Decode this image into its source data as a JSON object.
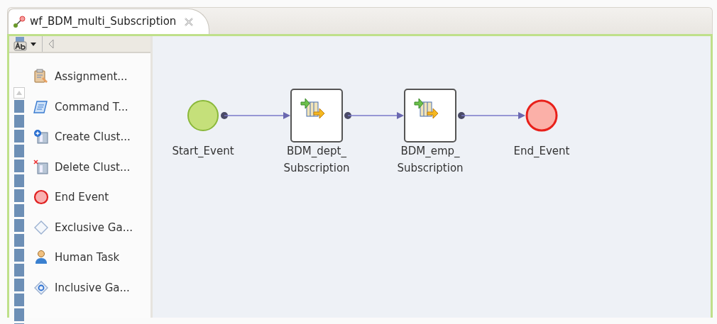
{
  "editor_tab": {
    "title": "wf_BDM_multi_Subscription",
    "selected": true
  },
  "palette": {
    "items": [
      {
        "label": "Assignment...",
        "kind": "assignment"
      },
      {
        "label": "Command  T...",
        "kind": "command"
      },
      {
        "label": "Create  Clust...",
        "kind": "create-cluster"
      },
      {
        "label": "Delete  Clust...",
        "kind": "delete-cluster"
      },
      {
        "label": "End Event",
        "kind": "end"
      },
      {
        "label": "Exclusive Ga...",
        "kind": "exclusive"
      },
      {
        "label": "Human Task",
        "kind": "human"
      },
      {
        "label": "Inclusive Ga...",
        "kind": "inclusive"
      }
    ]
  },
  "canvas": {
    "nodes": [
      {
        "kind": "start",
        "label_lines": [
          "Start_Event"
        ]
      },
      {
        "kind": "task",
        "label_lines": [
          "BDM_dept_",
          "Subscription"
        ]
      },
      {
        "kind": "task",
        "label_lines": [
          "BDM_emp_",
          "Subscription"
        ]
      },
      {
        "kind": "end",
        "label_lines": [
          "End_Event"
        ]
      }
    ]
  }
}
